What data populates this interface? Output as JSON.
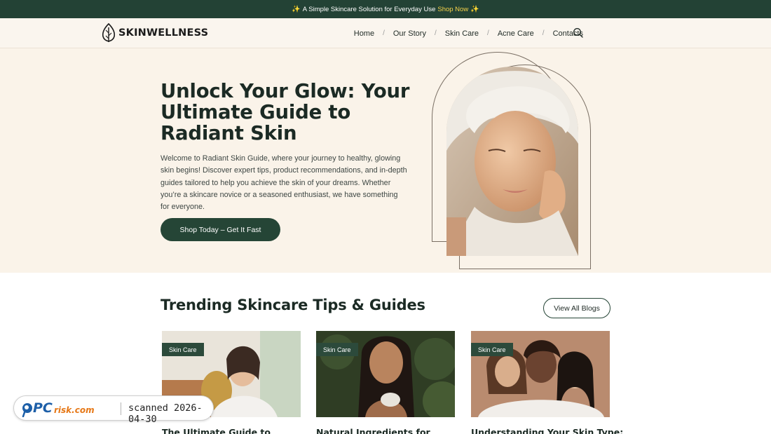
{
  "announcement": {
    "sparkle": "✨",
    "text": "A Simple Skincare Solution for Everyday Use",
    "link": "Shop Now",
    "sparkle_end": "✨"
  },
  "header": {
    "logo_text": "SKINWELLNESS",
    "nav": [
      "Home",
      "Our Story",
      "Skin Care",
      "Acne Care",
      "Contacts"
    ],
    "separator": "/"
  },
  "hero": {
    "title": "Unlock Your Glow: Your Ultimate Guide to Radiant Skin",
    "body": "Welcome to Radiant Skin Guide, where your journey to healthy, glowing skin begins! Discover expert tips, product recommendations, and in-depth guides tailored to help you achieve the skin of your dreams. Whether you’re a skincare novice or a seasoned enthusiast, we have something for everyone.",
    "cta": "Shop Today – Get It Fast"
  },
  "trending": {
    "title": "Trending Skincare Tips & Guides",
    "view_all": "View All Blogs",
    "cards": [
      {
        "tag": "Skin Care",
        "title": "The Ultimate Guide to"
      },
      {
        "tag": "Skin Care",
        "title": "Natural Ingredients for"
      },
      {
        "tag": "Skin Care",
        "title": "Understanding Your Skin Type:"
      }
    ]
  },
  "watermark": {
    "brand": "PCrisk.com",
    "text": "scanned 2026-04-30"
  },
  "colors": {
    "brand_green": "#234235",
    "hero_bg": "#faf3e9",
    "accent_yellow": "#f6d24a"
  }
}
